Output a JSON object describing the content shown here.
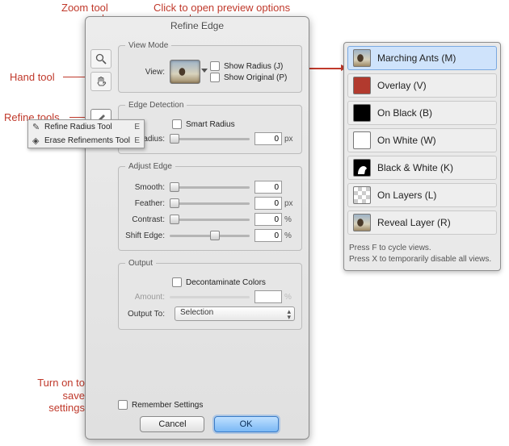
{
  "dialog": {
    "title": "Refine Edge",
    "view_mode": {
      "legend": "View Mode",
      "view_label": "View:",
      "show_radius": "Show Radius (J)",
      "show_original": "Show Original (P)"
    },
    "edge_detection": {
      "legend": "Edge Detection",
      "smart_radius": "Smart Radius",
      "radius_label": "Radius:",
      "radius_value": "0",
      "radius_unit": "px"
    },
    "adjust_edge": {
      "legend": "Adjust Edge",
      "smooth_label": "Smooth:",
      "smooth_value": "0",
      "feather_label": "Feather:",
      "feather_value": "0",
      "feather_unit": "px",
      "contrast_label": "Contrast:",
      "contrast_value": "0",
      "contrast_unit": "%",
      "shift_label": "Shift Edge:",
      "shift_value": "0",
      "shift_unit": "%"
    },
    "output": {
      "legend": "Output",
      "decontaminate": "Decontaminate Colors",
      "amount_label": "Amount:",
      "amount_value": "",
      "amount_unit": "%",
      "output_to_label": "Output To:",
      "output_to_value": "Selection"
    },
    "remember": "Remember Settings",
    "cancel": "Cancel",
    "ok": "OK"
  },
  "refine_popup": {
    "item1": "Refine Radius Tool",
    "key1": "E",
    "item2": "Erase Refinements Tool",
    "key2": "E"
  },
  "preview": {
    "items": [
      {
        "label": "Marching Ants (M)",
        "sel": true,
        "thumb": "horse"
      },
      {
        "label": "Overlay (V)",
        "sel": false,
        "thumb": "#b23a2e"
      },
      {
        "label": "On Black (B)",
        "sel": false,
        "thumb": "#000000"
      },
      {
        "label": "On White (W)",
        "sel": false,
        "thumb": "#ffffff"
      },
      {
        "label": "Black & White (K)",
        "sel": false,
        "thumb": "bw"
      },
      {
        "label": "On Layers (L)",
        "sel": false,
        "thumb": "checker"
      },
      {
        "label": "Reveal Layer (R)",
        "sel": false,
        "thumb": "horse"
      }
    ],
    "foot1": "Press F to cycle views.",
    "foot2": "Press X to temporarily disable all views."
  },
  "anno": {
    "zoom": "Zoom tool",
    "hand": "Hand tool",
    "refine": "Refine tools",
    "preview": "Click to open preview options",
    "save": "Turn on to save settings"
  }
}
